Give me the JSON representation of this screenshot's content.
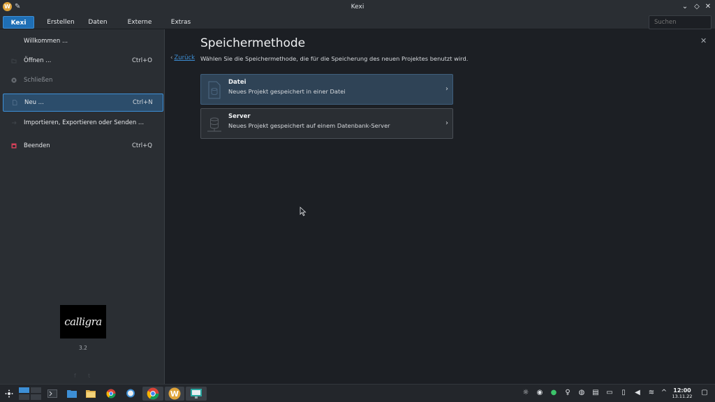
{
  "window": {
    "title": "Kexi"
  },
  "tabs": [
    {
      "label": "Kexi"
    },
    {
      "label": "Erstellen"
    },
    {
      "label": "Daten"
    },
    {
      "label": "Externe Daten"
    },
    {
      "label": "Extras"
    }
  ],
  "search": {
    "placeholder": "Suchen"
  },
  "menu": {
    "items": [
      {
        "label": "Willkommen ...",
        "shortcut": ""
      },
      {
        "label": "Öffnen ...",
        "shortcut": "Ctrl+O"
      },
      {
        "label": "Schließen",
        "shortcut": ""
      },
      {
        "label": "Neu ...",
        "shortcut": "Ctrl+N"
      },
      {
        "label": "Importieren, Exportieren oder Senden ...",
        "shortcut": ""
      },
      {
        "label": "Beenden",
        "shortcut": "Ctrl+Q"
      }
    ]
  },
  "branding": {
    "logo_text": "calligra",
    "version": "3.2"
  },
  "main": {
    "title": "Speichermethode",
    "back_label": "Zurück",
    "subtitle": "Wählen Sie die Speichermethode, die für die Speicherung des neuen Projektes benutzt wird.",
    "options": [
      {
        "title": "Datei",
        "description": "Neues Projekt gespeichert in einer Datei"
      },
      {
        "title": "Server",
        "description": "Neues Projekt gespeichert auf einem Datenbank-Server"
      }
    ]
  },
  "taskbar": {
    "time": "12:00",
    "date": "13.11.22"
  },
  "colors": {
    "accent": "#1f6fb5",
    "selection": "#2c4d6b",
    "link": "#3d8fd6",
    "background": "#1c1f24",
    "panel": "#2a2e33"
  }
}
